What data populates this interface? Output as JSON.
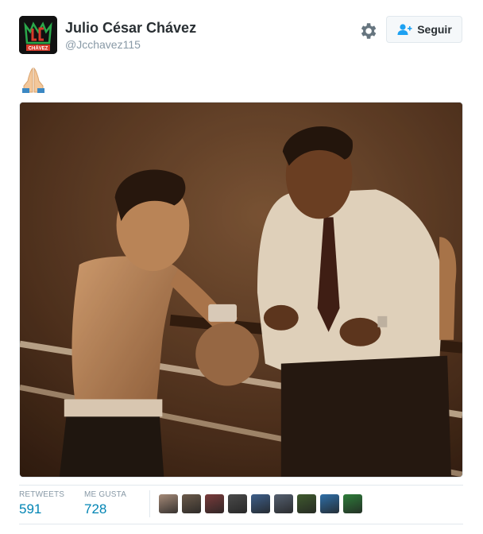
{
  "profile": {
    "name": "Julio César Chávez",
    "handle": "@Jcchavez115",
    "avatar_logo_text": "CHÁVEZ",
    "avatar_icon": "jcc-crown-logo"
  },
  "header": {
    "settings_icon": "gear-icon",
    "follow_label": "Seguir",
    "follow_icon": "add-user-icon"
  },
  "tweet": {
    "emoji": "🙏",
    "emoji_icon": "folded-hands-emoji"
  },
  "stats": {
    "retweets_label": "RETWEETS",
    "retweets_value": "591",
    "likes_label": "ME GUSTA",
    "likes_value": "728"
  },
  "likers": [
    {
      "color": "#a58a78"
    },
    {
      "color": "#6b5a4a"
    },
    {
      "color": "#7a3b3b"
    },
    {
      "color": "#4a4a4a"
    },
    {
      "color": "#3e5f8a"
    },
    {
      "color": "#556070"
    },
    {
      "color": "#3f5a2e"
    },
    {
      "color": "#2f6fa8"
    },
    {
      "color": "#2e7d3a"
    }
  ],
  "colors": {
    "link": "#0084b4",
    "muted": "#8899a6",
    "border": "#e1e8ed"
  }
}
